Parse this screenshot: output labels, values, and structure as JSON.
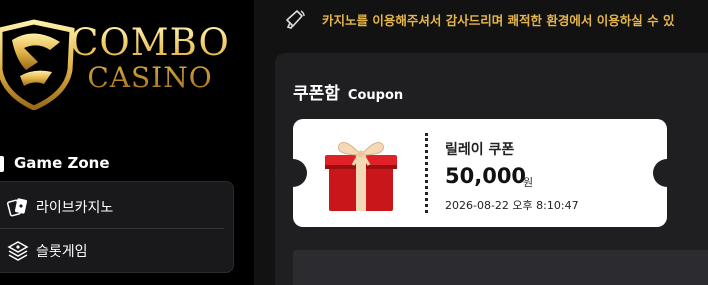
{
  "brand": {
    "line1": "COMBO",
    "line2": "CASINO"
  },
  "sidebar": {
    "zone_title": "Game Zone",
    "items": [
      {
        "label": "라이브카지노",
        "icon": "cards-icon"
      },
      {
        "label": "슬롯게임",
        "icon": "slot-stack-icon"
      }
    ]
  },
  "notice": {
    "icon": "megaphone-icon",
    "text": "카지노를 이용해주셔서 감사드리며 쾌적한 환경에서 이용하실 수 있"
  },
  "coupon_box": {
    "title_ko": "쿠폰함",
    "title_en": "Coupon",
    "coupons": [
      {
        "name": "릴레이 쿠폰",
        "amount": "50,000",
        "unit": "원",
        "date": "2026-08-22 오후 8:10:47",
        "image": "gift-box-icon"
      }
    ]
  },
  "colors": {
    "gold": "#e3b54a",
    "sidebar_bg": "#000000",
    "panel_bg": "#1f1f22",
    "coupon_bg": "#ffffff"
  }
}
